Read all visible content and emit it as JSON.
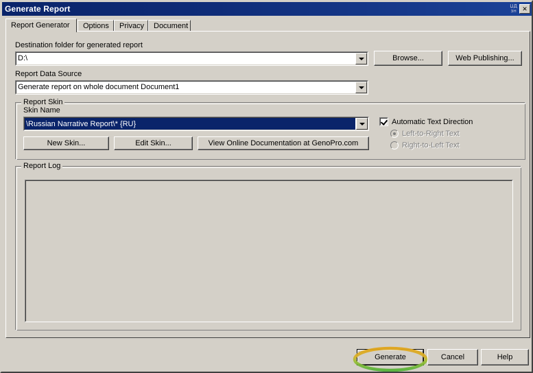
{
  "window": {
    "title": "Generate Report",
    "titlebar_artifact_top": "ЏД",
    "titlebar_artifact_bottom": "зн",
    "close_label": "✕"
  },
  "tabs": [
    {
      "label": "Report Generator",
      "selected": true
    },
    {
      "label": "Options",
      "selected": false
    },
    {
      "label": "Privacy",
      "selected": false
    },
    {
      "label": "Document",
      "selected": false
    }
  ],
  "destination": {
    "label": "Destination folder for generated report",
    "value": "D:\\",
    "placeholder": "",
    "dropdown_icon": "chevron-down-icon"
  },
  "data_source": {
    "label": "Report Data Source",
    "value": "Generate report on whole document Document1",
    "placeholder": "",
    "dropdown_icon": "chevron-down-icon"
  },
  "buttons": {
    "browse": "Browse...",
    "web_publishing": "Web Publishing...",
    "new_skin": "New Skin...",
    "edit_skin": "Edit Skin...",
    "view_docs": "View Online Documentation at GenoPro.com",
    "generate": "Generate",
    "cancel": "Cancel",
    "help": "Help"
  },
  "report_skin": {
    "group_title": "Report Skin",
    "skin_name_label": "Skin Name",
    "skin_name_value": "\\Russian Narrative Report\\*  {RU}",
    "dropdown_icon": "chevron-down-icon",
    "automatic_text_direction": {
      "label": "Automatic Text Direction",
      "checked": true
    },
    "ltr": {
      "label": "Left-to-Right Text",
      "selected": true,
      "disabled": true
    },
    "rtl": {
      "label": "Right-to-Left Text",
      "selected": false,
      "disabled": true
    }
  },
  "report_log": {
    "group_title": "Report Log",
    "content": ""
  },
  "colors": {
    "titlebar_start": "#0a246a",
    "titlebar_end": "#1b4298",
    "face": "#d4d0c8",
    "highlight": "#0a246a",
    "annotation_top": "#e8b52a",
    "annotation_bottom": "#5ab73a"
  }
}
